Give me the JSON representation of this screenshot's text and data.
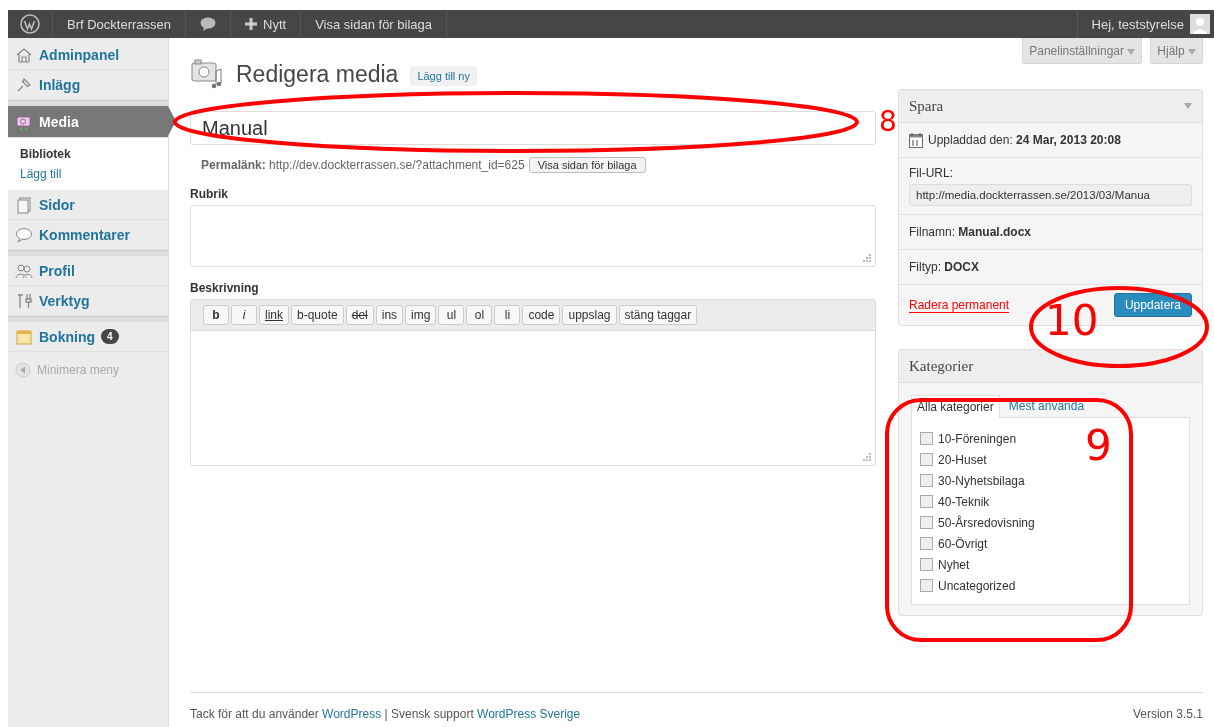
{
  "admin_bar": {
    "site": "Brf Dockterrassen",
    "new": "Nytt",
    "view": "Visa sidan för bilaga",
    "greeting": "Hej, teststyrelse"
  },
  "menu": [
    {
      "label": "Adminpanel",
      "kind": "home",
      "selected": false
    },
    {
      "label": "Inlägg",
      "kind": "pin",
      "selected": false
    },
    {
      "label": "Media",
      "kind": "media",
      "selected": true,
      "children": [
        {
          "label": "Bibliotek",
          "selected": true
        },
        {
          "label": "Lägg till",
          "selected": false
        }
      ]
    },
    {
      "label": "Sidor",
      "kind": "pages",
      "selected": false
    },
    {
      "label": "Kommentarer",
      "kind": "comment",
      "selected": false
    },
    {
      "label": "Profil",
      "kind": "users",
      "selected": false
    },
    {
      "label": "Verktyg",
      "kind": "tools",
      "selected": false
    },
    {
      "label": "Bokning",
      "kind": "calendar",
      "selected": false,
      "badge": "4"
    }
  ],
  "collapse": "Minimera meny",
  "screen_options": [
    "Panelinställningar",
    "Hjälp"
  ],
  "page": {
    "title": "Redigera media",
    "add_new": "Lägg till ny"
  },
  "title_field": {
    "value": "Manual"
  },
  "permalink": {
    "label": "Permalänk:",
    "url": "http://dev.dockterrassen.se/?attachment_id=625",
    "button": "Visa sidan för bilaga"
  },
  "caption": {
    "label": "Rubrik"
  },
  "description": {
    "label": "Beskrivning",
    "buttons": [
      {
        "label": "b",
        "kind": "bold"
      },
      {
        "label": "i",
        "kind": "italic"
      },
      {
        "label": "link",
        "kind": "underline"
      },
      {
        "label": "b-quote",
        "kind": "plain"
      },
      {
        "label": "del",
        "kind": "strike"
      },
      {
        "label": "ins",
        "kind": "plain"
      },
      {
        "label": "img",
        "kind": "plain"
      },
      {
        "label": "ul",
        "kind": "plain"
      },
      {
        "label": "ol",
        "kind": "plain"
      },
      {
        "label": "li",
        "kind": "plain"
      },
      {
        "label": "code",
        "kind": "plain"
      },
      {
        "label": "uppslag",
        "kind": "plain"
      },
      {
        "label": "stäng taggar",
        "kind": "plain"
      }
    ]
  },
  "publish": {
    "title": "Spara",
    "uploaded_label": "Uppladdad den:",
    "uploaded": "24 Mar, 2013 20:08",
    "url_label": "Fil-URL:",
    "url": "http://media.dockterrassen.se/2013/03/Manua",
    "filename_label": "Filnamn:",
    "filename": "Manual.docx",
    "filetype_label": "Filtyp:",
    "filetype": "DOCX",
    "delete": "Radera permanent",
    "update": "Uppdatera"
  },
  "categories": {
    "title": "Kategorier",
    "tabs": [
      {
        "label": "Alla kategorier",
        "selected": true
      },
      {
        "label": "Mest använda",
        "selected": false
      }
    ],
    "items": [
      {
        "label": "10-Föreningen",
        "checked": false
      },
      {
        "label": "20-Huset",
        "checked": false
      },
      {
        "label": "30-Nyhetsbilaga",
        "checked": false
      },
      {
        "label": "40-Teknik",
        "checked": false
      },
      {
        "label": "50-Årsredovisning",
        "checked": false
      },
      {
        "label": "60-Övrigt",
        "checked": false
      },
      {
        "label": "Nyhet",
        "checked": false
      },
      {
        "label": "Uncategorized",
        "checked": false
      }
    ]
  },
  "footer": {
    "parts": [
      {
        "text": "Tack för att du använder ",
        "kind": "text"
      },
      {
        "text": "WordPress",
        "kind": "link"
      },
      {
        "text": " | Svensk support ",
        "kind": "text"
      },
      {
        "text": "WordPress Sverige",
        "kind": "link"
      }
    ],
    "version": "Version 3.5.1"
  },
  "annotations": [
    {
      "label": "8",
      "kind": "ellipse"
    },
    {
      "label": "10",
      "kind": "ellipse"
    },
    {
      "label": "9",
      "kind": "rounded"
    }
  ]
}
